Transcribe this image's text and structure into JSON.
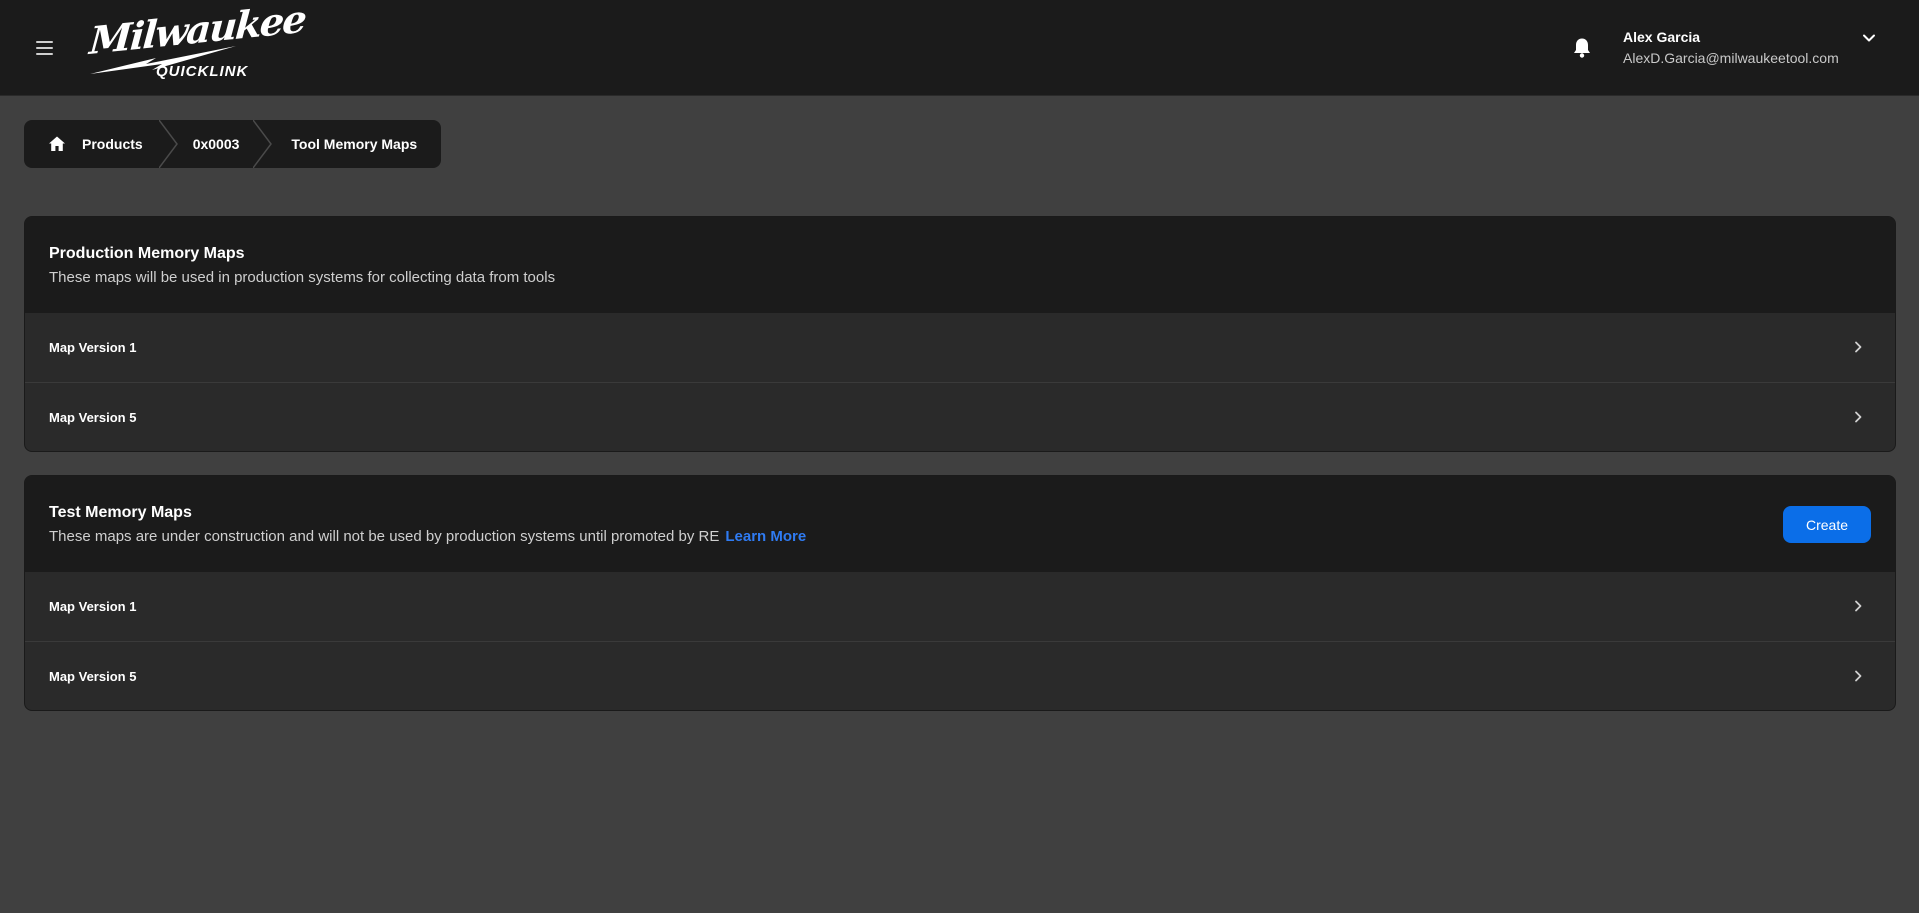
{
  "header": {
    "logo_text": "Milwaukee",
    "logo_subtext": "QUICKLINK",
    "menu_icon": "hamburger-menu-icon",
    "notification_icon": "bell-icon",
    "user": {
      "name": "Alex Garcia",
      "email": "AlexD.Garcia@milwaukeetool.com",
      "dropdown_icon": "chevron-down-icon"
    }
  },
  "breadcrumb": {
    "home_icon": "home-icon",
    "items": [
      "Products",
      "0x0003",
      "Tool Memory Maps"
    ]
  },
  "production": {
    "title": "Production Memory Maps",
    "description": "These maps will be used in production systems for collecting data from tools",
    "items": [
      "Map Version 1",
      "Map Version 5"
    ]
  },
  "test": {
    "title": "Test Memory Maps",
    "description": "These maps are under construction and will not be used by production systems until promoted by RE",
    "learn_more": "Learn More",
    "create_label": "Create",
    "items": [
      "Map Version 1",
      "Map Version 5"
    ]
  },
  "colors": {
    "background": "#404040",
    "header_bg": "#1b1b1b",
    "card_bg": "#2a2a2a",
    "accent": "#0b6ee8",
    "link": "#2f7bf2"
  }
}
